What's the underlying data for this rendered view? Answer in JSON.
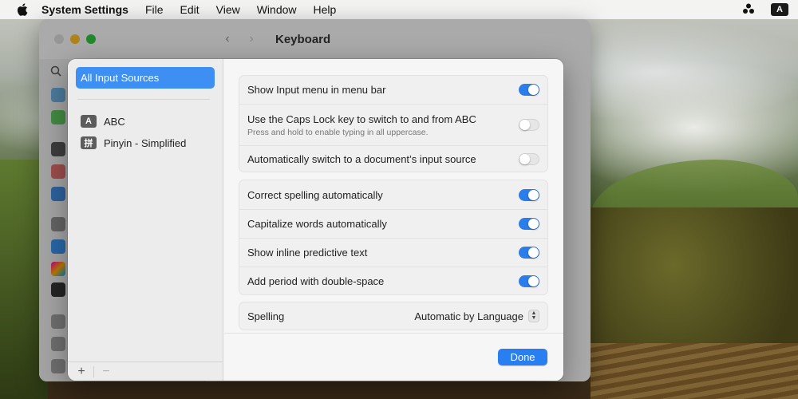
{
  "menubar": {
    "app_name": "System Settings",
    "items": [
      "File",
      "Edit",
      "View",
      "Window",
      "Help"
    ],
    "input_indicator": "A"
  },
  "window": {
    "title": "Keyboard"
  },
  "sheet": {
    "sources": {
      "all_label": "All Input Sources",
      "items": [
        {
          "glyph": "A",
          "label": "ABC"
        },
        {
          "glyph": "拼",
          "label": "Pinyin - Simplified"
        }
      ]
    },
    "sidebar_buttons": {
      "add": "+",
      "remove": "−"
    },
    "group1": [
      {
        "label": "Show Input menu in menu bar",
        "on": true
      },
      {
        "label": "Use the Caps Lock key to switch to and from ABC",
        "sub": "Press and hold to enable typing in all uppercase.",
        "on": false
      },
      {
        "label": "Automatically switch to a document’s input source",
        "on": false
      }
    ],
    "group2": [
      {
        "label": "Correct spelling automatically",
        "on": true
      },
      {
        "label": "Capitalize words automatically",
        "on": true
      },
      {
        "label": "Show inline predictive text",
        "on": true
      },
      {
        "label": "Add period with double-space",
        "on": true
      }
    ],
    "spelling": {
      "label": "Spelling",
      "value": "Automatic by Language"
    },
    "done_label": "Done"
  },
  "colors": {
    "accent": "#2b7de9",
    "selection": "#3e8ff3"
  }
}
